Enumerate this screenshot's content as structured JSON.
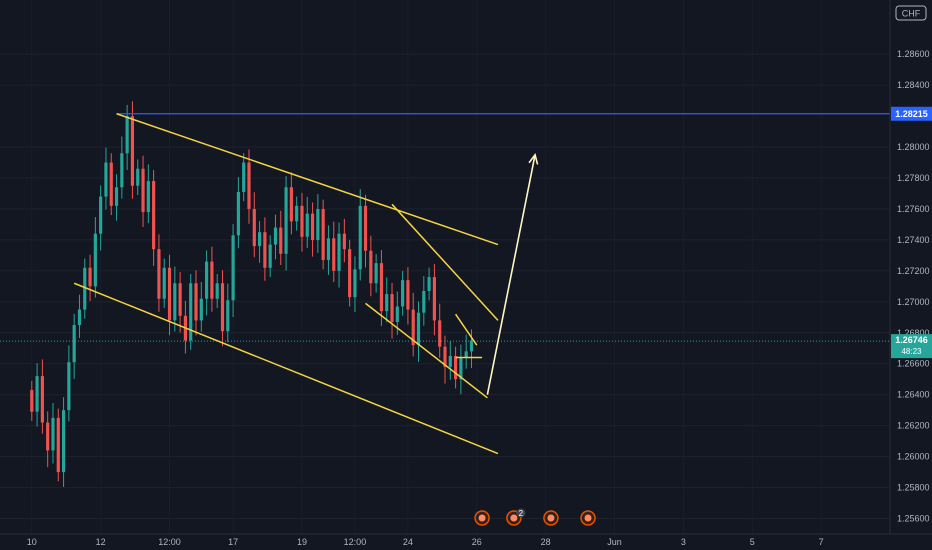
{
  "currency_badge": "CHF",
  "chart_data": {
    "type": "candlestick",
    "colors": {
      "background": "#131722",
      "up": "#26a69a",
      "down": "#ef5350",
      "trendline": "#f5d443",
      "arrow": "#fff7c2",
      "resistance": "#2962ff",
      "current_price": "#26a69a",
      "event_marker": "#e65100"
    },
    "y_axis": {
      "range": [
        1.255,
        1.2895
      ],
      "ticks": [
        "1.25600",
        "1.25800",
        "1.26000",
        "1.26200",
        "1.26400",
        "1.26600",
        "1.26800",
        "1.27000",
        "1.27200",
        "1.27400",
        "1.27600",
        "1.27800",
        "1.28000",
        "1.28400",
        "1.28600"
      ]
    },
    "x_axis": {
      "ticks": [
        {
          "label": "10",
          "idx": 0
        },
        {
          "label": "12",
          "idx": 13
        },
        {
          "label": "12:00",
          "idx": 26
        },
        {
          "label": "17",
          "idx": 38
        },
        {
          "label": "19",
          "idx": 51
        },
        {
          "label": "12:00",
          "idx": 61
        },
        {
          "label": "24",
          "idx": 71
        },
        {
          "label": "26",
          "idx": 84
        },
        {
          "label": "28",
          "idx": 97
        },
        {
          "label": "Jun",
          "idx": 110
        },
        {
          "label": "3",
          "idx": 123
        },
        {
          "label": "5",
          "idx": 136
        },
        {
          "label": "7",
          "idx": 149
        }
      ],
      "range_idx": [
        -6,
        162
      ]
    },
    "resistance_level": {
      "label": "1.28215",
      "value": 1.28215,
      "from_idx": 16
    },
    "current_price": {
      "label": "1.26746",
      "countdown": "48:23",
      "value": 1.26746
    },
    "candles": [
      [
        1.2643,
        1.2629
      ],
      [
        1.2629,
        1.2652
      ],
      [
        1.2652,
        1.2622
      ],
      [
        1.2622,
        1.2604
      ],
      [
        1.2604,
        1.2625
      ],
      [
        1.2625,
        1.259
      ],
      [
        1.259,
        1.263
      ],
      [
        1.263,
        1.2661
      ],
      [
        1.2661,
        1.2685
      ],
      [
        1.2685,
        1.2695
      ],
      [
        1.2695,
        1.2722
      ],
      [
        1.2722,
        1.271
      ],
      [
        1.271,
        1.2744
      ],
      [
        1.2744,
        1.2768
      ],
      [
        1.2768,
        1.279
      ],
      [
        1.279,
        1.2762
      ],
      [
        1.2762,
        1.2774
      ],
      [
        1.2774,
        1.2796
      ],
      [
        1.2796,
        1.282
      ],
      [
        1.282,
        1.2775
      ],
      [
        1.2775,
        1.2786
      ],
      [
        1.2786,
        1.2758
      ],
      [
        1.2758,
        1.2778
      ],
      [
        1.2778,
        1.2734
      ],
      [
        1.2734,
        1.2702
      ],
      [
        1.2702,
        1.2722
      ],
      [
        1.2722,
        1.2688
      ],
      [
        1.2688,
        1.2712
      ],
      [
        1.2712,
        1.2691
      ],
      [
        1.2691,
        1.2675
      ],
      [
        1.2675,
        1.2712
      ],
      [
        1.2712,
        1.2688
      ],
      [
        1.2688,
        1.2702
      ],
      [
        1.2702,
        1.2726
      ],
      [
        1.2726,
        1.2702
      ],
      [
        1.2702,
        1.2712
      ],
      [
        1.2712,
        1.2681
      ],
      [
        1.2681,
        1.2701
      ],
      [
        1.2701,
        1.2743
      ],
      [
        1.2743,
        1.2771
      ],
      [
        1.2771,
        1.279
      ],
      [
        1.279,
        1.276
      ],
      [
        1.276,
        1.2736
      ],
      [
        1.2736,
        1.2745
      ],
      [
        1.2745,
        1.2722
      ],
      [
        1.2722,
        1.2737
      ],
      [
        1.2737,
        1.2748
      ],
      [
        1.2748,
        1.2731
      ],
      [
        1.2731,
        1.2774
      ],
      [
        1.2774,
        1.2752
      ],
      [
        1.2752,
        1.2762
      ],
      [
        1.2762,
        1.2742
      ],
      [
        1.2742,
        1.2757
      ],
      [
        1.2757,
        1.274
      ],
      [
        1.274,
        1.276
      ],
      [
        1.276,
        1.2727
      ],
      [
        1.2727,
        1.2741
      ],
      [
        1.2741,
        1.272
      ],
      [
        1.272,
        1.2744
      ],
      [
        1.2744,
        1.2734
      ],
      [
        1.2734,
        1.2703
      ],
      [
        1.2703,
        1.2721
      ],
      [
        1.2721,
        1.2762
      ],
      [
        1.2762,
        1.2733
      ],
      [
        1.2733,
        1.2712
      ],
      [
        1.2712,
        1.2725
      ],
      [
        1.2725,
        1.2694
      ],
      [
        1.2694,
        1.2705
      ],
      [
        1.2705,
        1.2687
      ],
      [
        1.2687,
        1.2697
      ],
      [
        1.2697,
        1.2714
      ],
      [
        1.2714,
        1.2695
      ],
      [
        1.2695,
        1.2672
      ],
      [
        1.2672,
        1.2693
      ],
      [
        1.2693,
        1.2707
      ],
      [
        1.2707,
        1.2716
      ],
      [
        1.2716,
        1.2688
      ],
      [
        1.2688,
        1.2671
      ],
      [
        1.2671,
        1.2658
      ],
      [
        1.2658,
        1.2665
      ],
      [
        1.2665,
        1.265
      ],
      [
        1.265,
        1.2664
      ],
      [
        1.2664,
        1.2668
      ],
      [
        1.2668,
        1.2675
      ]
    ],
    "trendlines": [
      {
        "name": "channel-upper",
        "p1": [
          16,
          1.28215
        ],
        "p2": [
          88,
          1.2737
        ]
      },
      {
        "name": "channel-lower",
        "p1": [
          8,
          1.2712
        ],
        "p2": [
          88,
          1.2602
        ]
      },
      {
        "name": "wedge-upper",
        "p1": [
          68,
          1.2763
        ],
        "p2": [
          88,
          1.2688
        ]
      },
      {
        "name": "wedge-lower",
        "p1": [
          63,
          1.2699
        ],
        "p2": [
          86,
          1.2638
        ]
      },
      {
        "name": "pennant-upper",
        "p1": [
          80,
          1.2692
        ],
        "p2": [
          84,
          1.2672
        ]
      },
      {
        "name": "pennant-lower",
        "p1": [
          80,
          1.2664
        ],
        "p2": [
          85,
          1.2664
        ]
      }
    ],
    "projection_arrow": {
      "from": [
        86,
        1.264
      ],
      "to": [
        95,
        1.2795
      ]
    },
    "event_markers": [
      {
        "idx": 85,
        "count": ""
      },
      {
        "idx": 91,
        "count": "2"
      },
      {
        "idx": 98,
        "count": ""
      },
      {
        "idx": 105,
        "count": ""
      }
    ]
  }
}
